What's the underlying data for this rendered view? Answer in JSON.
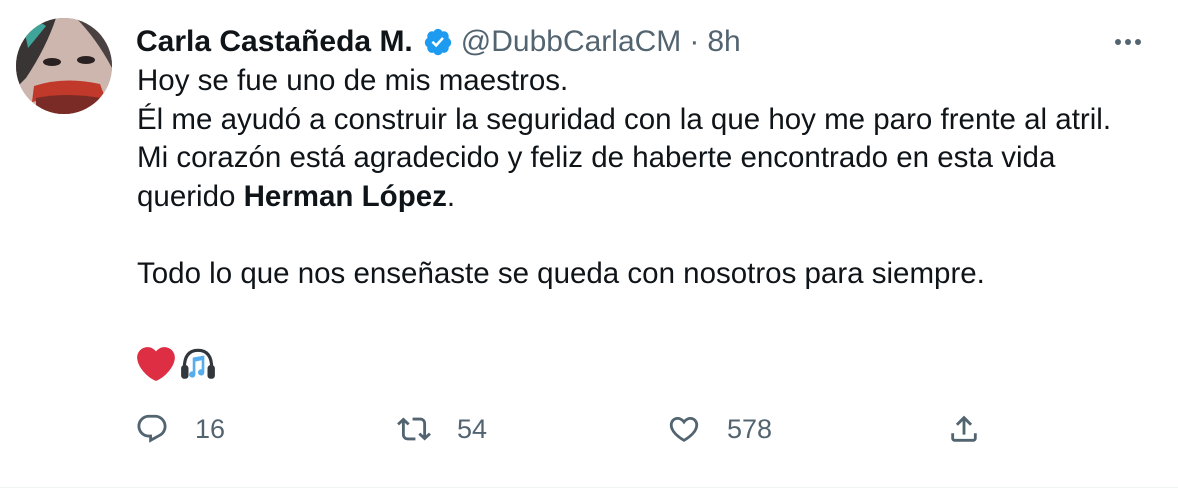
{
  "author": {
    "name": "Carla Castañeda M.",
    "handle": "@DubbCarlaCM",
    "separator": "·",
    "time": "8h",
    "verified": true
  },
  "tweet": {
    "line1": "Hoy se fue uno de mis maestros.",
    "line2": "Él me ayudó a construir la seguridad con la que hoy me paro frente al atril.",
    "line3": "Mi corazón está agradecido y feliz de haberte encontrado en esta vida",
    "line4_prefix": "querido ",
    "line4_bold": "Herman López",
    "line4_suffix": ".",
    "line5": "Todo lo que nos enseñaste se queda con nosotros para siempre.",
    "emojis": [
      "heart-emoji",
      "headphones-emoji"
    ]
  },
  "actions": {
    "reply_count": "16",
    "retweet_count": "54",
    "like_count": "578"
  },
  "colors": {
    "text": "#0f1419",
    "secondary": "#536471",
    "verified": "#1d9bf0",
    "heart": "#dd2e44"
  }
}
